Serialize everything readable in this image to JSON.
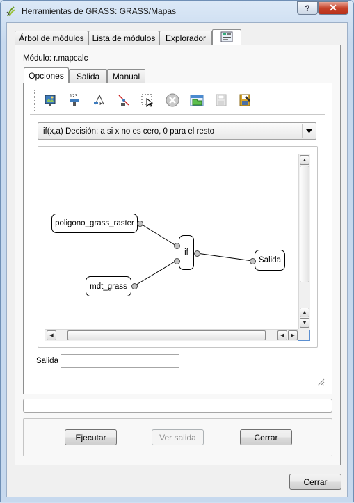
{
  "window": {
    "title": "Herramientas de GRASS: GRASS/Mapas",
    "help_label": "?",
    "close_label": "✕"
  },
  "main_tabs": [
    {
      "label": "Árbol de módulos"
    },
    {
      "label": "Lista de módulos"
    },
    {
      "label": "Explorador"
    },
    {
      "label": "",
      "icon": "module-icon"
    }
  ],
  "module": {
    "label": "Módulo: r.mapcalc"
  },
  "sub_tabs": [
    {
      "label": "Opciones"
    },
    {
      "label": "Salida"
    },
    {
      "label": "Manual"
    }
  ],
  "toolbar": {
    "icons": [
      "add-map-icon",
      "add-constant-icon",
      "add-operator-icon",
      "add-connection-icon",
      "select-icon",
      "delete-icon",
      "open-icon",
      "save-icon",
      "save-as-icon"
    ]
  },
  "function_combo": {
    "value": "if(x,a)  Decisión: a si x no es cero, 0 para el resto"
  },
  "graph": {
    "nodes": [
      {
        "label": "poligono_grass_raster"
      },
      {
        "label": "mdt_grass"
      },
      {
        "label": "if"
      },
      {
        "label": "Salida"
      }
    ]
  },
  "output": {
    "label": "Salida",
    "value": ""
  },
  "progress": {
    "value": ""
  },
  "buttons": {
    "run": "Ejecutar",
    "view_output": "Ver salida",
    "close": "Cerrar",
    "dialog_close": "Cerrar"
  }
}
